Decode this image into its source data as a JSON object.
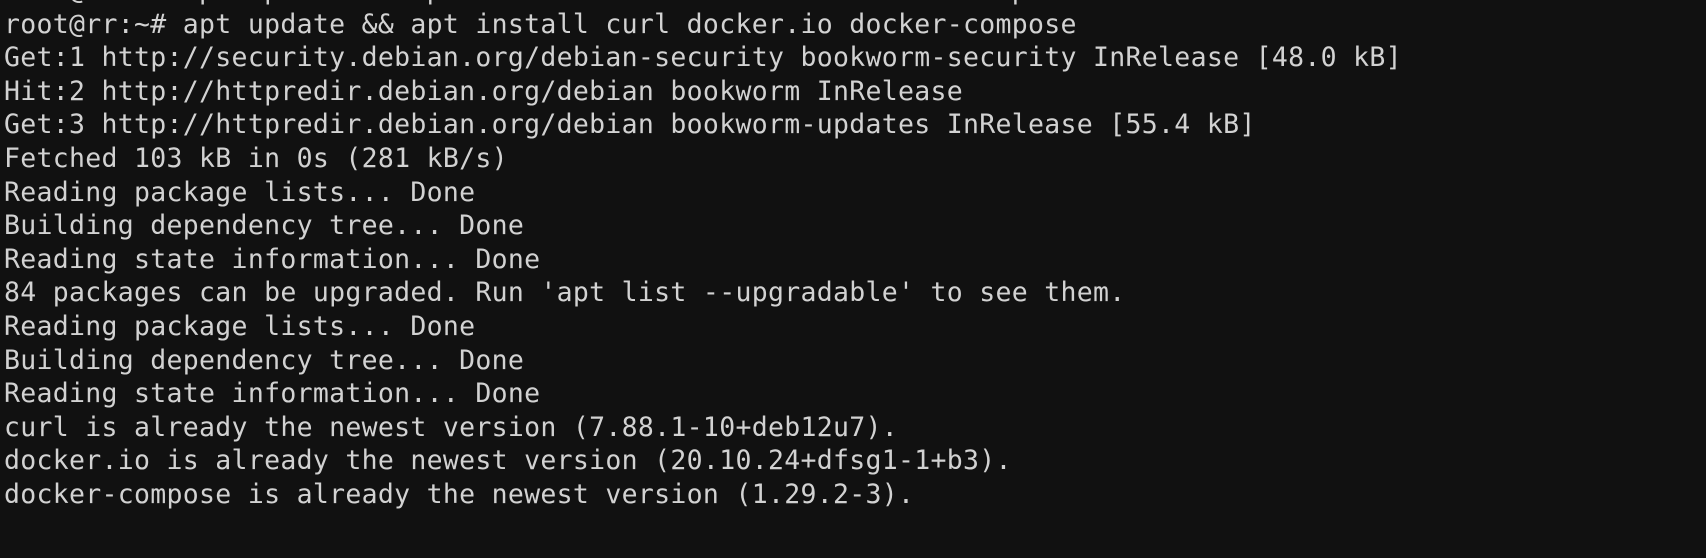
{
  "terminal": {
    "theme": {
      "background": "#111111",
      "foreground": "#d2d2d2"
    },
    "prompt": {
      "user": "root",
      "host": "rr",
      "cwd": "~",
      "symbol": "#",
      "full": "root@rr:~#"
    },
    "command": "apt update && apt install curl docker.io docker-compose",
    "scrollback_partial_top": "root@rr:~# apt update && apt install curl docker.io docker-compose",
    "lines": [
      "root@rr:~# apt update && apt install curl docker.io docker-compose",
      "Get:1 http://security.debian.org/debian-security bookworm-security InRelease [48.0 kB]",
      "Hit:2 http://httpredir.debian.org/debian bookworm InRelease",
      "Get:3 http://httpredir.debian.org/debian bookworm-updates InRelease [55.4 kB]",
      "Fetched 103 kB in 0s (281 kB/s)",
      "Reading package lists... Done",
      "Building dependency tree... Done",
      "Reading state information... Done",
      "84 packages can be upgraded. Run 'apt list --upgradable' to see them.",
      "Reading package lists... Done",
      "Building dependency tree... Done",
      "Reading state information... Done",
      "curl is already the newest version (7.88.1-10+deb12u7).",
      "docker.io is already the newest version (20.10.24+dfsg1-1+b3).",
      "docker-compose is already the newest version (1.29.2-3)."
    ],
    "details": {
      "repositories": [
        {
          "index": "Get:1",
          "url": "http://security.debian.org/debian-security",
          "suite": "bookworm-security",
          "file": "InRelease",
          "size": "48.0 kB"
        },
        {
          "index": "Hit:2",
          "url": "http://httpredir.debian.org/debian",
          "suite": "bookworm",
          "file": "InRelease",
          "size": ""
        },
        {
          "index": "Get:3",
          "url": "http://httpredir.debian.org/debian",
          "suite": "bookworm-updates",
          "file": "InRelease",
          "size": "55.4 kB"
        }
      ],
      "fetched_total": "103 kB",
      "fetched_time": "0s",
      "fetched_rate": "281 kB/s",
      "upgradable_count": "84",
      "upgradable_hint": "apt list --upgradable",
      "packages": [
        {
          "name": "curl",
          "status": "is already the newest version",
          "version": "7.88.1-10+deb12u7"
        },
        {
          "name": "docker.io",
          "status": "is already the newest version",
          "version": "20.10.24+dfsg1-1+b3"
        },
        {
          "name": "docker-compose",
          "status": "is already the newest version",
          "version": "1.29.2-3"
        }
      ]
    }
  }
}
